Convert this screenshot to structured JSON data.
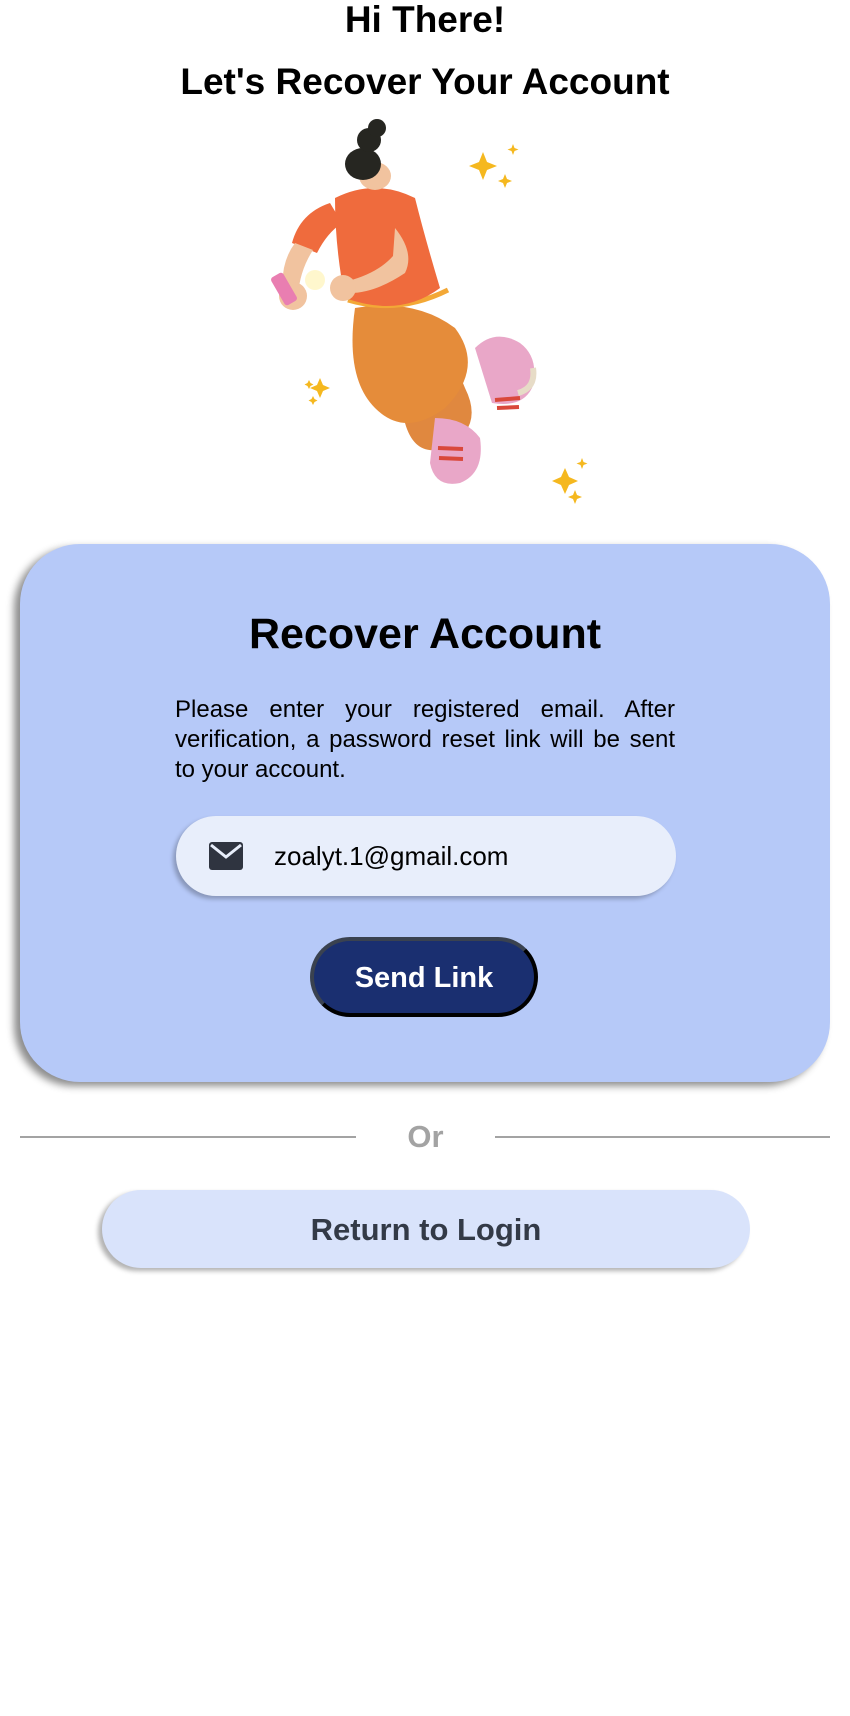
{
  "header": {
    "greeting": "Hi There!",
    "subtitle": "Let's Recover Your Account"
  },
  "illustration": {
    "icon": "person-with-phone-sparkles-illustration"
  },
  "card": {
    "title": "Recover Account",
    "description": "Please enter your registered email. After verification, a password reset link will be sent to your account.",
    "email_field": {
      "icon": "envelope-icon",
      "value": "zoalyt.1@gmail.com"
    },
    "send_label": "Send Link"
  },
  "divider": {
    "label": "Or"
  },
  "return_label": "Return to Login",
  "colors": {
    "card_background": "#b6c9f8",
    "input_background": "#e8eefb",
    "primary_button": "#1a2f70",
    "secondary_button": "#d9e3fb",
    "divider": "#a3a3a3"
  }
}
